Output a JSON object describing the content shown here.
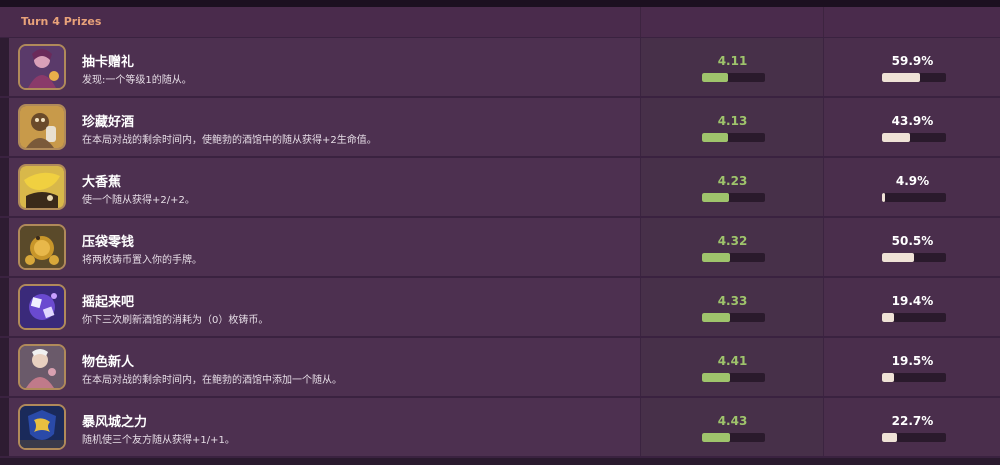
{
  "header": {
    "title": "Turn 4 Prizes"
  },
  "colors": {
    "score_bar": "#9fc46c",
    "pct_bar": "#efe2d6",
    "header_title": "#e8a27a",
    "row_bg": "#4d3050"
  },
  "rows": [
    {
      "name": "抽卡赠礼",
      "desc": "发现:一个等级1的随从。",
      "score": "4.11",
      "score_fraction": 0.42,
      "pct": "59.9%",
      "pct_value": 59.9,
      "icon": "card-gift-portrait"
    },
    {
      "name": "珍藏好酒",
      "desc": "在本局对战的剩余时间内，使鲍勃的酒馆中的随从获得+2生命值。",
      "score": "4.13",
      "score_fraction": 0.42,
      "pct": "43.9%",
      "pct_value": 43.9,
      "icon": "fine-wine-portrait"
    },
    {
      "name": "大香蕉",
      "desc": "使一个随从获得+2/+2。",
      "score": "4.23",
      "score_fraction": 0.43,
      "pct": "4.9%",
      "pct_value": 4.9,
      "icon": "big-banana-portrait"
    },
    {
      "name": "压袋零钱",
      "desc": "将两枚铸币置入你的手牌。",
      "score": "4.32",
      "score_fraction": 0.44,
      "pct": "50.5%",
      "pct_value": 50.5,
      "icon": "pocket-change-portrait"
    },
    {
      "name": "摇起来吧",
      "desc": "你下三次刷新酒馆的消耗为（0）枚铸币。",
      "score": "4.33",
      "score_fraction": 0.44,
      "pct": "19.4%",
      "pct_value": 19.4,
      "icon": "shake-it-portrait"
    },
    {
      "name": "物色新人",
      "desc": "在本局对战的剩余时间内，在鲍勃的酒馆中添加一个随从。",
      "score": "4.41",
      "score_fraction": 0.45,
      "pct": "19.5%",
      "pct_value": 19.5,
      "icon": "new-recruit-portrait"
    },
    {
      "name": "暴风城之力",
      "desc": "随机使三个友方随从获得+1/+1。",
      "score": "4.43",
      "score_fraction": 0.45,
      "pct": "22.7%",
      "pct_value": 22.7,
      "icon": "stormwind-might-portrait"
    }
  ]
}
